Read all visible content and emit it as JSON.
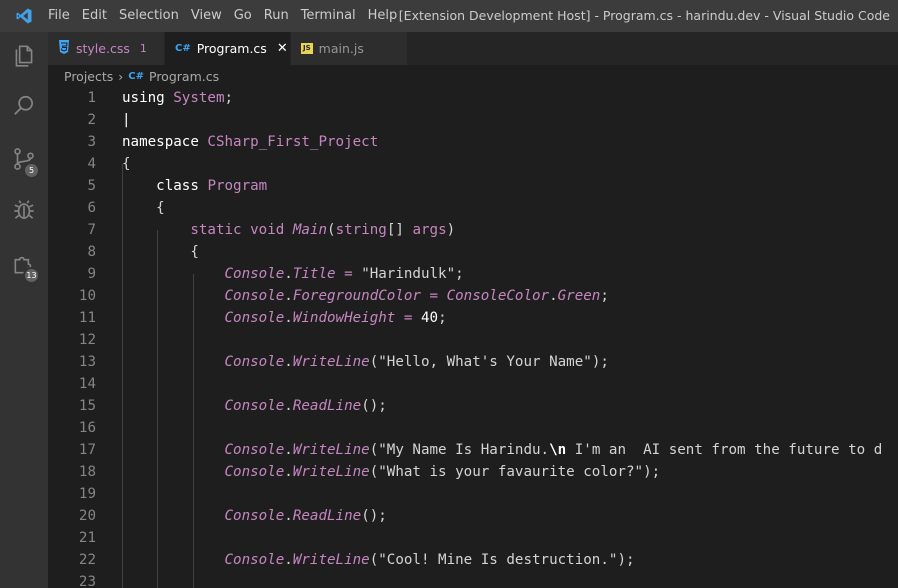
{
  "window_title": "[Extension Development Host] - Program.cs - harindu.dev - Visual Studio Code",
  "menu": [
    "File",
    "Edit",
    "Selection",
    "View",
    "Go",
    "Run",
    "Terminal",
    "Help"
  ],
  "activity": {
    "source_control_badge": "5",
    "extensions_badge": "13"
  },
  "tabs": [
    {
      "icon": "css",
      "label": "style.css",
      "extra": "1"
    },
    {
      "icon": "C#",
      "label": "Program.cs",
      "extra": "✕"
    },
    {
      "icon": "JS",
      "label": "main.js",
      "extra": ""
    }
  ],
  "breadcrumb": {
    "folder": "Projects",
    "file_icon": "C#",
    "file": "Program.cs"
  },
  "code_lines": [
    {
      "n": "1",
      "tokens": [
        [
          "kw",
          "using"
        ],
        [
          "pn",
          " "
        ],
        [
          "pk",
          "System"
        ],
        [
          "pn",
          ";"
        ]
      ]
    },
    {
      "n": "2",
      "tokens": [
        [
          "kw",
          "|"
        ]
      ]
    },
    {
      "n": "3",
      "tokens": [
        [
          "kw",
          "namespace"
        ],
        [
          "pn",
          " "
        ],
        [
          "pk",
          "CSharp_First_Project"
        ]
      ]
    },
    {
      "n": "4",
      "tokens": [
        [
          "pn",
          "{"
        ]
      ]
    },
    {
      "n": "5",
      "tokens": [
        [
          "pn",
          "    "
        ],
        [
          "kw",
          "class"
        ],
        [
          "pn",
          " "
        ],
        [
          "pk",
          "Program"
        ]
      ]
    },
    {
      "n": "6",
      "tokens": [
        [
          "pn",
          "    {"
        ]
      ]
    },
    {
      "n": "7",
      "tokens": [
        [
          "pn",
          "        "
        ],
        [
          "pk",
          "static"
        ],
        [
          "pn",
          " "
        ],
        [
          "pk",
          "void"
        ],
        [
          "pn",
          " "
        ],
        [
          "fn",
          "Main"
        ],
        [
          "pn",
          "("
        ],
        [
          "pk",
          "string"
        ],
        [
          "pn",
          "[] "
        ],
        [
          "pk",
          "args"
        ],
        [
          "pn",
          ")"
        ]
      ]
    },
    {
      "n": "8",
      "tokens": [
        [
          "pn",
          "        {"
        ]
      ]
    },
    {
      "n": "9",
      "tokens": [
        [
          "pn",
          "            "
        ],
        [
          "it",
          "Console"
        ],
        [
          "pn",
          "."
        ],
        [
          "it",
          "Title"
        ],
        [
          "pk",
          " = "
        ],
        [
          "str",
          "\"Harindulk\""
        ],
        [
          "pn",
          ";"
        ]
      ]
    },
    {
      "n": "10",
      "tokens": [
        [
          "pn",
          "            "
        ],
        [
          "it",
          "Console"
        ],
        [
          "pn",
          "."
        ],
        [
          "it",
          "ForegroundColor"
        ],
        [
          "pk",
          " = "
        ],
        [
          "it",
          "ConsoleColor"
        ],
        [
          "pn",
          "."
        ],
        [
          "it",
          "Green"
        ],
        [
          "pn",
          ";"
        ]
      ]
    },
    {
      "n": "11",
      "tokens": [
        [
          "pn",
          "            "
        ],
        [
          "it",
          "Console"
        ],
        [
          "pn",
          "."
        ],
        [
          "it",
          "WindowHeight"
        ],
        [
          "pk",
          " = "
        ],
        [
          "num",
          "40"
        ],
        [
          "pn",
          ";"
        ]
      ]
    },
    {
      "n": "12",
      "tokens": []
    },
    {
      "n": "13",
      "tokens": [
        [
          "pn",
          "            "
        ],
        [
          "it",
          "Console"
        ],
        [
          "pn",
          "."
        ],
        [
          "fn",
          "WriteLine"
        ],
        [
          "pn",
          "("
        ],
        [
          "str",
          "\"Hello, What's Your Name\""
        ],
        [
          "pn",
          ");"
        ]
      ]
    },
    {
      "n": "14",
      "tokens": []
    },
    {
      "n": "15",
      "tokens": [
        [
          "pn",
          "            "
        ],
        [
          "it",
          "Console"
        ],
        [
          "pn",
          "."
        ],
        [
          "fn",
          "ReadLine"
        ],
        [
          "pn",
          "();"
        ]
      ]
    },
    {
      "n": "16",
      "tokens": []
    },
    {
      "n": "17",
      "tokens": [
        [
          "pn",
          "            "
        ],
        [
          "it",
          "Console"
        ],
        [
          "pn",
          "."
        ],
        [
          "fn",
          "WriteLine"
        ],
        [
          "pn",
          "("
        ],
        [
          "str",
          "\"My Name Is Harindu."
        ],
        [
          "esc",
          "\\n"
        ],
        [
          "str",
          " I'm an  AI sent from the future to d"
        ]
      ]
    },
    {
      "n": "18",
      "tokens": [
        [
          "pn",
          "            "
        ],
        [
          "it",
          "Console"
        ],
        [
          "pn",
          "."
        ],
        [
          "fn",
          "WriteLine"
        ],
        [
          "pn",
          "("
        ],
        [
          "str",
          "\"What is your favaurite color?\""
        ],
        [
          "pn",
          ");"
        ]
      ]
    },
    {
      "n": "19",
      "tokens": []
    },
    {
      "n": "20",
      "tokens": [
        [
          "pn",
          "            "
        ],
        [
          "it",
          "Console"
        ],
        [
          "pn",
          "."
        ],
        [
          "fn",
          "ReadLine"
        ],
        [
          "pn",
          "();"
        ]
      ]
    },
    {
      "n": "21",
      "tokens": []
    },
    {
      "n": "22",
      "tokens": [
        [
          "pn",
          "            "
        ],
        [
          "it",
          "Console"
        ],
        [
          "pn",
          "."
        ],
        [
          "fn",
          "WriteLine"
        ],
        [
          "pn",
          "("
        ],
        [
          "str",
          "\"Cool! Mine Is destruction.\""
        ],
        [
          "pn",
          ");"
        ]
      ]
    },
    {
      "n": "23",
      "tokens": []
    }
  ]
}
